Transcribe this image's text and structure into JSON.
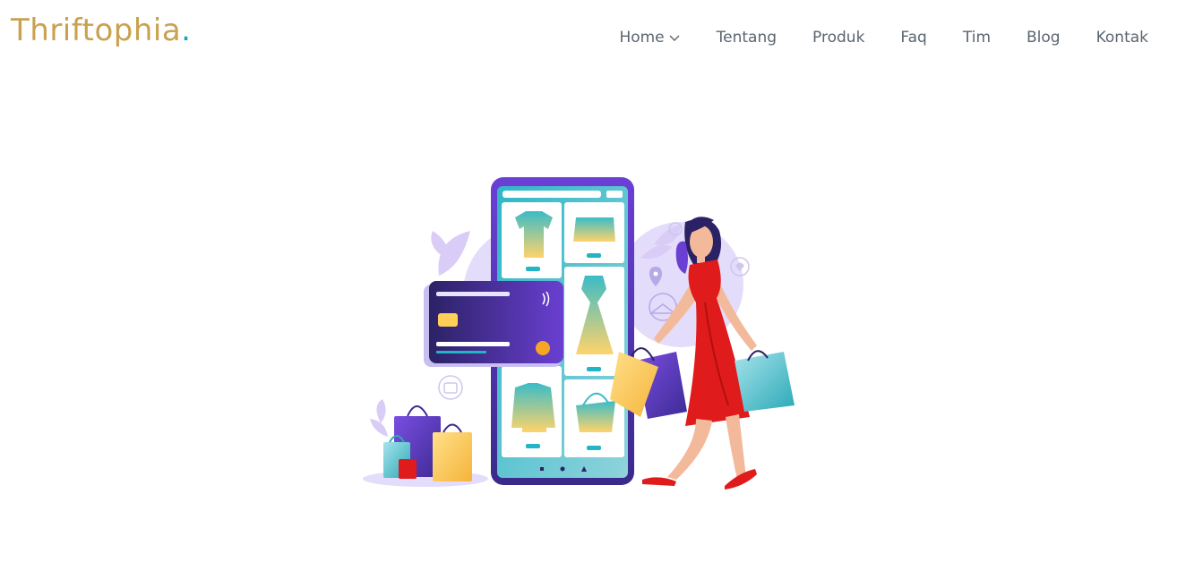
{
  "header": {
    "logo_text": "Thriftophia",
    "logo_dot": ".",
    "nav_items": [
      {
        "label": "Home",
        "has_dropdown": true
      },
      {
        "label": "Tentang"
      },
      {
        "label": "Produk"
      },
      {
        "label": "Faq"
      },
      {
        "label": "Tim"
      },
      {
        "label": "Blog"
      },
      {
        "label": "Kontak"
      }
    ]
  },
  "colors": {
    "logo": "#c9a14f",
    "logo_dot": "#17a2b8",
    "nav_text": "#5b6570",
    "phone_purple": "#6a3fd1",
    "accent_teal": "#22b5c5",
    "accent_yellow": "#ffcf57",
    "dress_red": "#e01b1b",
    "lavender": "#e3dcfa"
  },
  "hero": {
    "illustration": "online-shopping-illustration"
  }
}
